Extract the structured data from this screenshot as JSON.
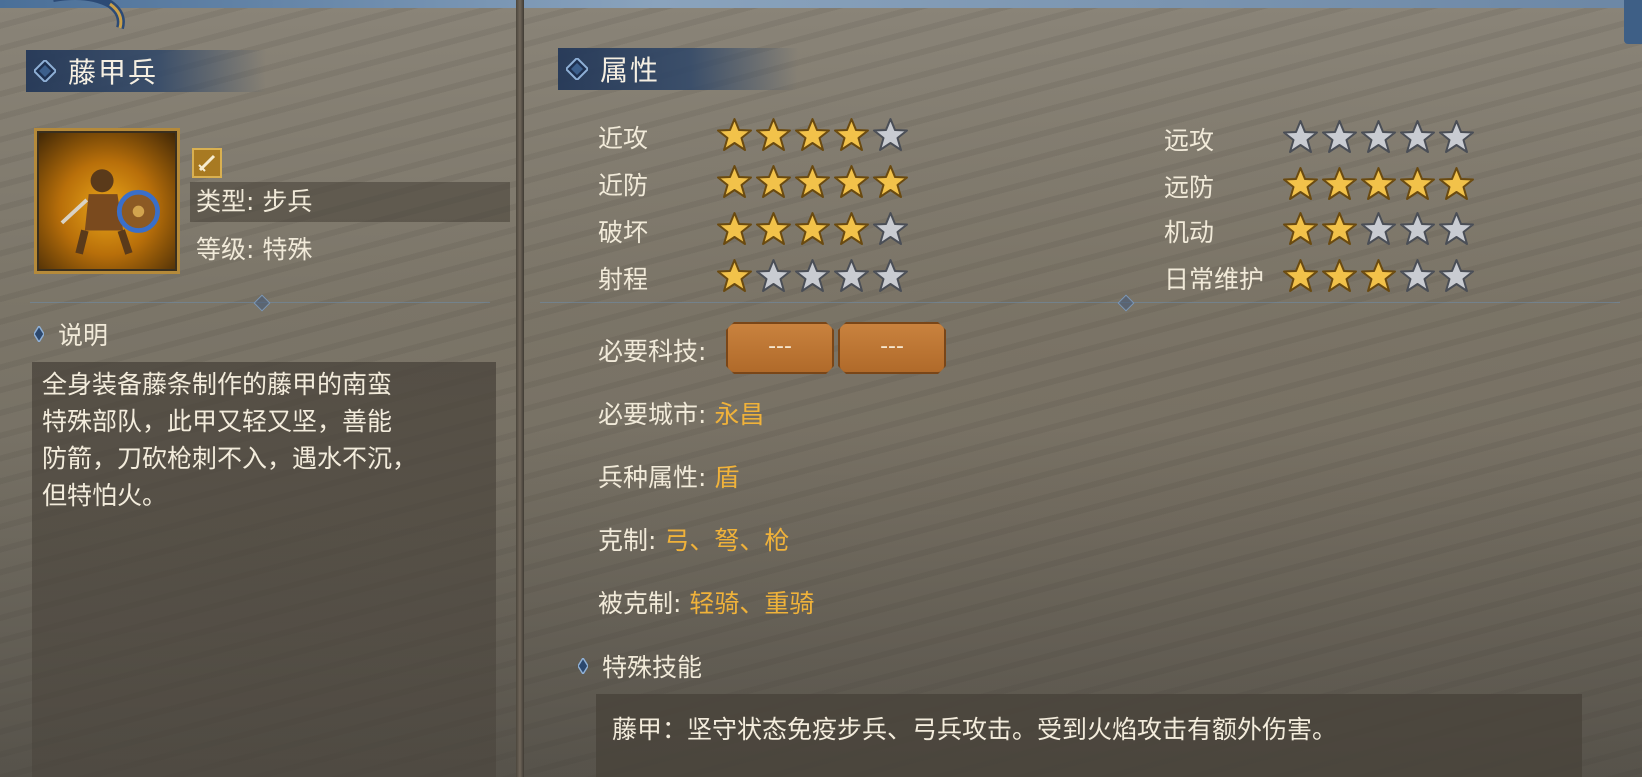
{
  "unit": {
    "name": "藤甲兵",
    "type_label": "类型: 步兵",
    "grade_label": "等级: 特殊",
    "description_header": "说明",
    "description_lines": [
      "全身装备藤条制作的藤甲的南蛮",
      "特殊部队，此甲又轻又坚，善能",
      "防箭，刀砍枪刺不入，遇水不沉，",
      "但特怕火。"
    ]
  },
  "attributes": {
    "header": "属性",
    "left_stats": [
      {
        "label": "近攻",
        "rating": 4,
        "max": 5
      },
      {
        "label": "近防",
        "rating": 5,
        "max": 5
      },
      {
        "label": "破坏",
        "rating": 4,
        "max": 5
      },
      {
        "label": "射程",
        "rating": 1,
        "max": 5
      }
    ],
    "right_stats": [
      {
        "label": "远攻",
        "rating": 0,
        "max": 5
      },
      {
        "label": "远防",
        "rating": 5,
        "max": 5
      },
      {
        "label": "机动",
        "rating": 2,
        "max": 5
      },
      {
        "label": "日常维护",
        "rating": 3,
        "max": 5
      }
    ],
    "required_tech_label": "必要科技:",
    "required_tech_slots": [
      "---",
      "---"
    ],
    "required_city_label": "必要城市:",
    "required_city_value": "永昌",
    "unit_attribute_label": "兵种属性:",
    "unit_attribute_value": "盾",
    "counters_label": "克制:",
    "counters_value": "弓、弩、枪",
    "countered_by_label": "被克制:",
    "countered_by_value": "轻骑、重骑",
    "special_skill_header": "特殊技能",
    "special_skill_text": "藤甲：坚守状态免疫步兵、弓兵攻击。受到火焰攻击有额外伤害。"
  },
  "colors": {
    "accent_gold": "#f0b23a",
    "header_blue": "#243858",
    "star_gold": "#f2c24a",
    "star_grey": "#c9ccd2"
  },
  "icons": {
    "portrait": "vine-armor-soldier-portrait",
    "class_badge": "sword-icon",
    "star_filled": "star-filled-icon",
    "star_empty": "star-empty-icon"
  }
}
